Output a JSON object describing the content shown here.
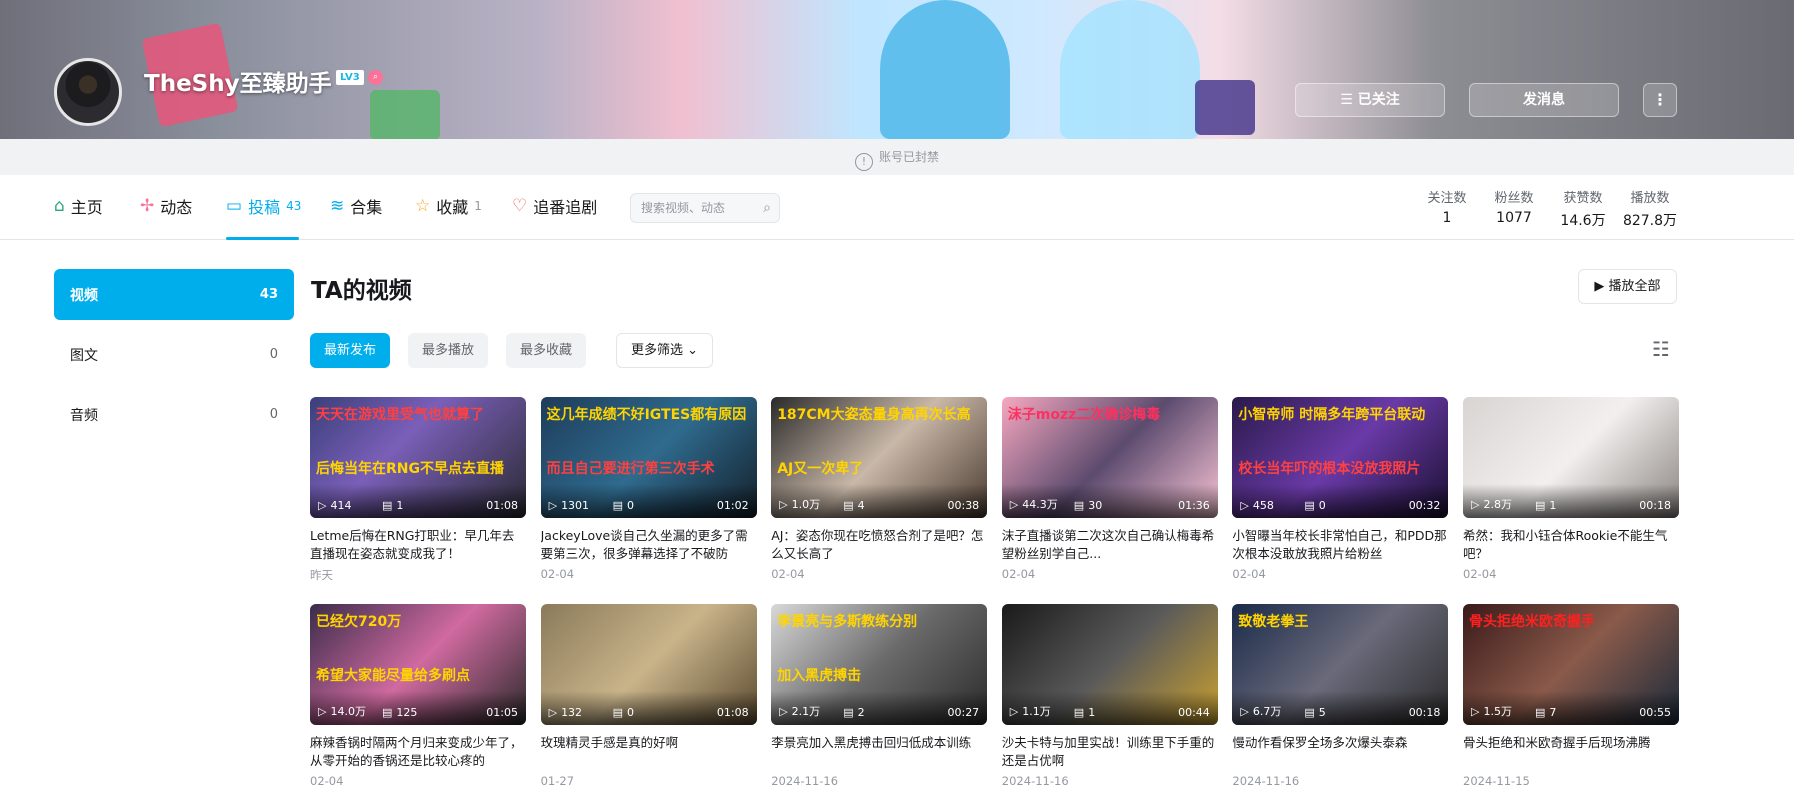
{
  "header": {
    "username": "TheShy至臻助手",
    "level": "LV3",
    "follow_label": "☰ 已关注",
    "message_label": "发消息",
    "more_label": "⋮"
  },
  "banned_notice": "账号已封禁",
  "nav": {
    "items": [
      {
        "label": "主页",
        "count": ""
      },
      {
        "label": "动态",
        "count": ""
      },
      {
        "label": "投稿",
        "count": "43"
      },
      {
        "label": "合集",
        "count": ""
      },
      {
        "label": "收藏",
        "count": "1"
      },
      {
        "label": "追番追剧",
        "count": ""
      }
    ],
    "search_placeholder": "搜索视频、动态"
  },
  "stats": [
    {
      "label": "关注数",
      "value": "1"
    },
    {
      "label": "粉丝数",
      "value": "1077"
    },
    {
      "label": "获赞数",
      "value": "14.6万"
    },
    {
      "label": "播放数",
      "value": "827.8万"
    }
  ],
  "sidebar": [
    {
      "label": "视频",
      "count": "43"
    },
    {
      "label": "图文",
      "count": "0"
    },
    {
      "label": "音频",
      "count": "0"
    }
  ],
  "main": {
    "title": "TA的视频",
    "play_all": "▶ 播放全部",
    "filters": [
      "最新发布",
      "最多播放",
      "最多收藏"
    ],
    "more_filter": "更多筛选 ⌄"
  },
  "videos": [
    {
      "views": "414",
      "danmaku": "1",
      "duration": "01:08",
      "title": "Letme后悔在RNG打职业：早几年去直播现在姿态就变成我了！",
      "date": "昨天",
      "cap1": "天天在游戏里受气也就算了",
      "cap2": "后悔当年在RNG不早点去直播"
    },
    {
      "views": "1301",
      "danmaku": "0",
      "duration": "01:02",
      "title": "JackeyLove谈自己久坐漏的更多了需要第三次，很多弹幕选择了不破防",
      "date": "02-04",
      "cap1": "这几年成绩不好IGTES都有原因",
      "cap2": "而且自己要进行第三次手术"
    },
    {
      "views": "1.0万",
      "danmaku": "4",
      "duration": "00:38",
      "title": "AJ：姿态你现在吃愤怒合剂了是吧？怎么又长高了",
      "date": "02-04",
      "cap1": "187CM大姿态量身高再次长高",
      "cap2": "AJ又一次卑了"
    },
    {
      "views": "44.3万",
      "danmaku": "30",
      "duration": "01:36",
      "title": "沫子直播谈第二次这次自己确认梅毒希望粉丝别学自己...",
      "date": "02-04",
      "cap1": "沫子mozz二次确诊梅毒",
      "cap2": ""
    },
    {
      "views": "458",
      "danmaku": "0",
      "duration": "00:32",
      "title": "小智曝当年校长非常怕自己，和PDD那次根本没敢放我照片给粉丝",
      "date": "02-04",
      "cap1": "小智帝师 时隔多年跨平台联动",
      "cap2": "校长当年吓的根本没放我照片"
    },
    {
      "views": "2.8万",
      "danmaku": "1",
      "duration": "00:18",
      "title": "希然：我和小钰合体Rookie不能生气吧？",
      "date": "02-04",
      "cap1": "",
      "cap2": ""
    },
    {
      "views": "14.0万",
      "danmaku": "125",
      "duration": "01:05",
      "title": "麻辣香锅时隔两个月归来变成少年了，从零开始的香锅还是比较心疼的",
      "date": "02-04",
      "cap1": "已经欠720万",
      "cap2": "希望大家能尽量给多刷点"
    },
    {
      "views": "132",
      "danmaku": "0",
      "duration": "01:08",
      "title": "玫瑰精灵手感是真的好啊",
      "date": "01-27",
      "cap1": "",
      "cap2": ""
    },
    {
      "views": "2.1万",
      "danmaku": "2",
      "duration": "00:27",
      "title": "李景亮加入黑虎搏击回归低成本训练",
      "date": "2024-11-16",
      "cap1": "李景亮与多斯教练分别",
      "cap2": "加入黑虎搏击"
    },
    {
      "views": "1.1万",
      "danmaku": "1",
      "duration": "00:44",
      "title": "沙夫卡特与加里实战！训练里下手重的还是占优啊",
      "date": "2024-11-16",
      "cap1": "",
      "cap2": ""
    },
    {
      "views": "6.7万",
      "danmaku": "5",
      "duration": "00:18",
      "title": "慢动作看保罗全场多次爆头泰森",
      "date": "2024-11-16",
      "cap1": "致敬老拳王",
      "cap2": ""
    },
    {
      "views": "1.5万",
      "danmaku": "7",
      "duration": "00:55",
      "title": "骨头拒绝和米欧奇握手后现场沸腾",
      "date": "2024-11-15",
      "cap1": "骨头拒绝米欧奇握手",
      "cap2": ""
    }
  ],
  "colors": {
    "accent": "#00aeec",
    "pink": "#fb7299"
  }
}
